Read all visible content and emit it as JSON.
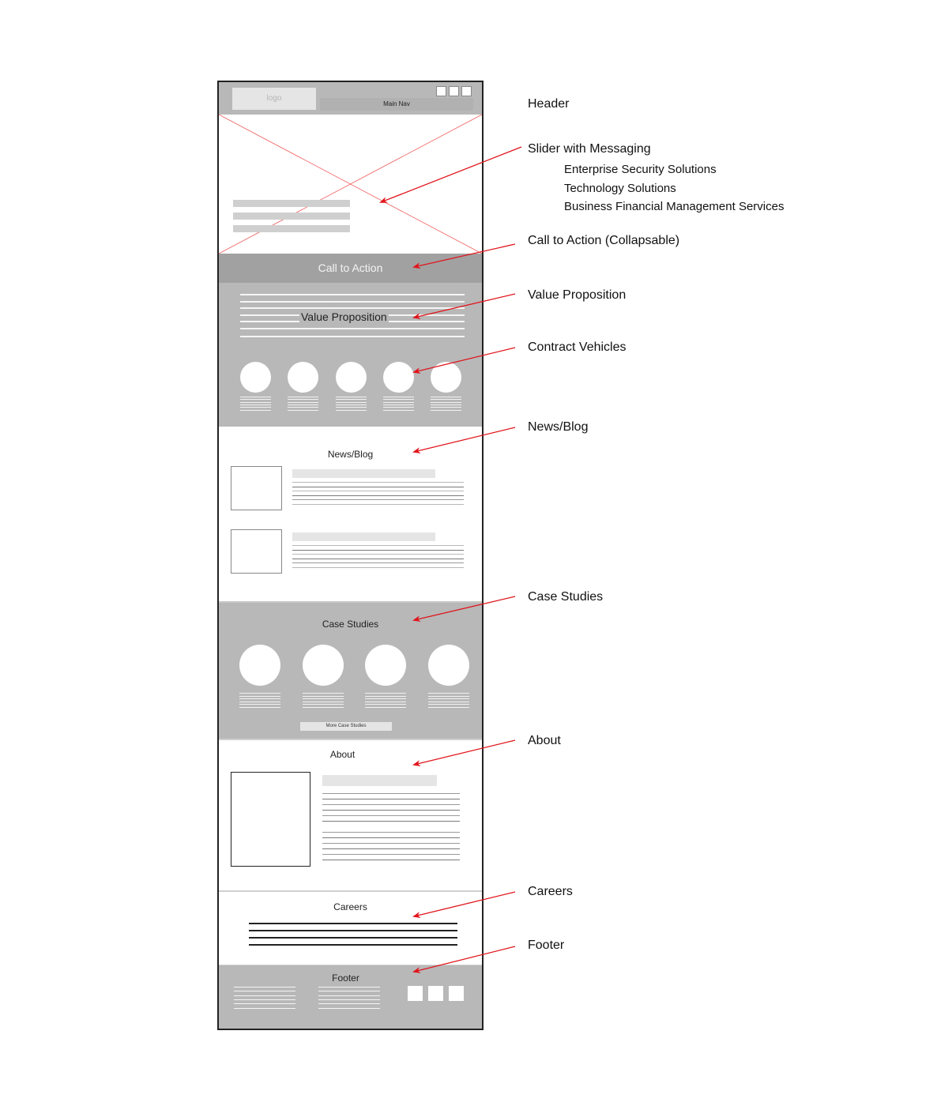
{
  "wireframe": {
    "header": {
      "logo_label": "logo",
      "main_nav_label": "Main Nav",
      "header_button_count": 3
    },
    "slider": {
      "placeholder": "image-placeholder-x",
      "text_bar_count": 3
    },
    "cta": {
      "label": "Call to Action"
    },
    "value_proposition": {
      "label": "Value Proposition"
    },
    "contract_vehicles": {
      "item_count": 5
    },
    "news": {
      "title": "News/Blog",
      "post_count": 2
    },
    "case_studies": {
      "title": "Case Studies",
      "item_count": 4,
      "more_button_label": "More Case Studies"
    },
    "about": {
      "title": "About"
    },
    "careers": {
      "title": "Careers",
      "listing_count": 4
    },
    "footer": {
      "title": "Footer",
      "social_icon_count": 3
    }
  },
  "annotations": {
    "header": "Header",
    "slider": "Slider with Messaging",
    "slider_messages": [
      "Enterprise Security Solutions",
      "Technology Solutions",
      "Business Financial Management Services"
    ],
    "cta": "Call to Action (Collapsable)",
    "value_proposition": "Value Proposition",
    "contract_vehicles": "Contract Vehicles",
    "news": "News/Blog",
    "case_studies": "Case Studies",
    "about": "About",
    "careers": "Careers",
    "footer": "Footer"
  },
  "colors": {
    "arrow": "#e0151b",
    "placeholder_x": "#f06060",
    "section_gray": "#b8b8b8",
    "cta_gray": "#a1a1a1",
    "frame_border": "#222222"
  }
}
